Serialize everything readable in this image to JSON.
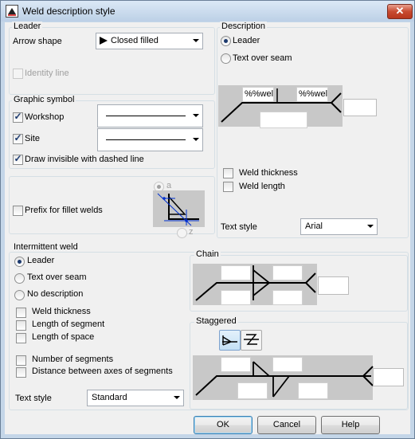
{
  "window": {
    "title": "Weld description style",
    "close_glyph": "✕"
  },
  "leader_group": {
    "label": "Leader",
    "arrow_shape_label": "Arrow shape",
    "arrow_shape_value": "Closed filled",
    "identity_line_label": "Identity line",
    "identity_line_checked": false
  },
  "graphic_symbol_group": {
    "label": "Graphic symbol",
    "workshop_label": "Workshop",
    "workshop_checked": true,
    "site_label": "Site",
    "site_checked": true,
    "dashed_label": "Draw invisible with dashed line",
    "dashed_checked": true
  },
  "prefix_group": {
    "prefix_label": "Prefix for fillet welds",
    "prefix_checked": false,
    "radio_a": "a",
    "radio_z": "z"
  },
  "description_group": {
    "label": "Description",
    "leader_label": "Leader",
    "text_over_seam_label": "Text over seam",
    "selected": "Leader",
    "weld_text_1": "%%weld",
    "weld_text_2": "%%weld",
    "weld_thickness_label": "Weld thickness",
    "weld_length_label": "Weld length",
    "text_style_label": "Text style",
    "text_style_value": "Arial"
  },
  "intermittent_group": {
    "label": "Intermittent weld",
    "leader_label": "Leader",
    "text_over_seam_label": "Text over seam",
    "no_description_label": "No description",
    "selected": "Leader",
    "weld_thickness_label": "Weld thickness",
    "length_of_segment_label": "Length of segment",
    "length_of_space_label": "Length of space",
    "number_of_segments_label": "Number of segments",
    "distance_label": "Distance between axes of segments",
    "text_style_label": "Text style",
    "text_style_value": "Standard"
  },
  "chain_group": {
    "label": "Chain"
  },
  "staggered_group": {
    "label": "Staggered"
  },
  "buttons": {
    "ok": "OK",
    "cancel": "Cancel",
    "help": "Help"
  },
  "colors": {
    "title_bg": "#c4d6e8",
    "dialog_bg": "#f0f0f0",
    "close_red": "#c84a30",
    "preview_gray": "#c8c8c8",
    "check_blue": "#1c3a6e"
  },
  "icons": {
    "app": "weld-app-icon",
    "close": "close-icon",
    "check": "checkmark-icon"
  }
}
